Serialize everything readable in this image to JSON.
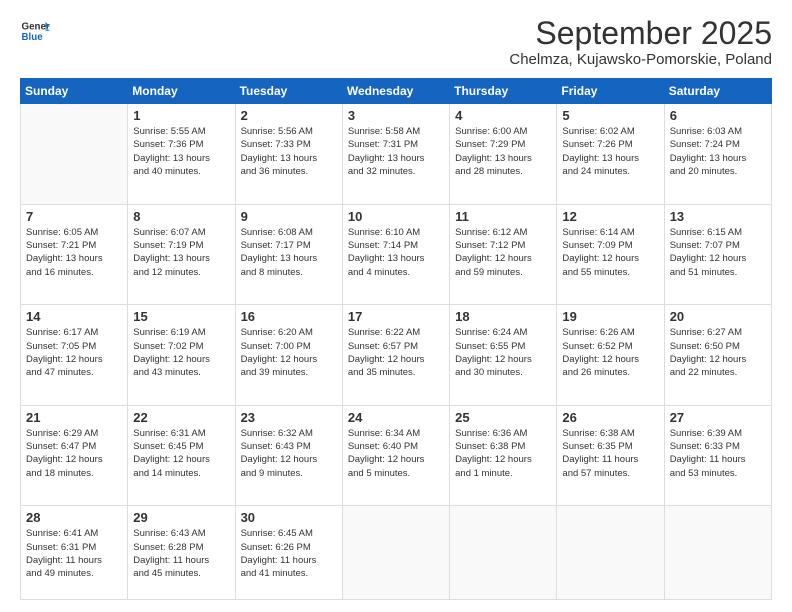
{
  "logo": {
    "general": "General",
    "blue": "Blue"
  },
  "header": {
    "month": "September 2025",
    "location": "Chelmza, Kujawsko-Pomorskie, Poland"
  },
  "weekdays": [
    "Sunday",
    "Monday",
    "Tuesday",
    "Wednesday",
    "Thursday",
    "Friday",
    "Saturday"
  ],
  "weeks": [
    [
      {
        "day": "",
        "info": ""
      },
      {
        "day": "1",
        "info": "Sunrise: 5:55 AM\nSunset: 7:36 PM\nDaylight: 13 hours\nand 40 minutes."
      },
      {
        "day": "2",
        "info": "Sunrise: 5:56 AM\nSunset: 7:33 PM\nDaylight: 13 hours\nand 36 minutes."
      },
      {
        "day": "3",
        "info": "Sunrise: 5:58 AM\nSunset: 7:31 PM\nDaylight: 13 hours\nand 32 minutes."
      },
      {
        "day": "4",
        "info": "Sunrise: 6:00 AM\nSunset: 7:29 PM\nDaylight: 13 hours\nand 28 minutes."
      },
      {
        "day": "5",
        "info": "Sunrise: 6:02 AM\nSunset: 7:26 PM\nDaylight: 13 hours\nand 24 minutes."
      },
      {
        "day": "6",
        "info": "Sunrise: 6:03 AM\nSunset: 7:24 PM\nDaylight: 13 hours\nand 20 minutes."
      }
    ],
    [
      {
        "day": "7",
        "info": "Sunrise: 6:05 AM\nSunset: 7:21 PM\nDaylight: 13 hours\nand 16 minutes."
      },
      {
        "day": "8",
        "info": "Sunrise: 6:07 AM\nSunset: 7:19 PM\nDaylight: 13 hours\nand 12 minutes."
      },
      {
        "day": "9",
        "info": "Sunrise: 6:08 AM\nSunset: 7:17 PM\nDaylight: 13 hours\nand 8 minutes."
      },
      {
        "day": "10",
        "info": "Sunrise: 6:10 AM\nSunset: 7:14 PM\nDaylight: 13 hours\nand 4 minutes."
      },
      {
        "day": "11",
        "info": "Sunrise: 6:12 AM\nSunset: 7:12 PM\nDaylight: 12 hours\nand 59 minutes."
      },
      {
        "day": "12",
        "info": "Sunrise: 6:14 AM\nSunset: 7:09 PM\nDaylight: 12 hours\nand 55 minutes."
      },
      {
        "day": "13",
        "info": "Sunrise: 6:15 AM\nSunset: 7:07 PM\nDaylight: 12 hours\nand 51 minutes."
      }
    ],
    [
      {
        "day": "14",
        "info": "Sunrise: 6:17 AM\nSunset: 7:05 PM\nDaylight: 12 hours\nand 47 minutes."
      },
      {
        "day": "15",
        "info": "Sunrise: 6:19 AM\nSunset: 7:02 PM\nDaylight: 12 hours\nand 43 minutes."
      },
      {
        "day": "16",
        "info": "Sunrise: 6:20 AM\nSunset: 7:00 PM\nDaylight: 12 hours\nand 39 minutes."
      },
      {
        "day": "17",
        "info": "Sunrise: 6:22 AM\nSunset: 6:57 PM\nDaylight: 12 hours\nand 35 minutes."
      },
      {
        "day": "18",
        "info": "Sunrise: 6:24 AM\nSunset: 6:55 PM\nDaylight: 12 hours\nand 30 minutes."
      },
      {
        "day": "19",
        "info": "Sunrise: 6:26 AM\nSunset: 6:52 PM\nDaylight: 12 hours\nand 26 minutes."
      },
      {
        "day": "20",
        "info": "Sunrise: 6:27 AM\nSunset: 6:50 PM\nDaylight: 12 hours\nand 22 minutes."
      }
    ],
    [
      {
        "day": "21",
        "info": "Sunrise: 6:29 AM\nSunset: 6:47 PM\nDaylight: 12 hours\nand 18 minutes."
      },
      {
        "day": "22",
        "info": "Sunrise: 6:31 AM\nSunset: 6:45 PM\nDaylight: 12 hours\nand 14 minutes."
      },
      {
        "day": "23",
        "info": "Sunrise: 6:32 AM\nSunset: 6:43 PM\nDaylight: 12 hours\nand 9 minutes."
      },
      {
        "day": "24",
        "info": "Sunrise: 6:34 AM\nSunset: 6:40 PM\nDaylight: 12 hours\nand 5 minutes."
      },
      {
        "day": "25",
        "info": "Sunrise: 6:36 AM\nSunset: 6:38 PM\nDaylight: 12 hours\nand 1 minute."
      },
      {
        "day": "26",
        "info": "Sunrise: 6:38 AM\nSunset: 6:35 PM\nDaylight: 11 hours\nand 57 minutes."
      },
      {
        "day": "27",
        "info": "Sunrise: 6:39 AM\nSunset: 6:33 PM\nDaylight: 11 hours\nand 53 minutes."
      }
    ],
    [
      {
        "day": "28",
        "info": "Sunrise: 6:41 AM\nSunset: 6:31 PM\nDaylight: 11 hours\nand 49 minutes."
      },
      {
        "day": "29",
        "info": "Sunrise: 6:43 AM\nSunset: 6:28 PM\nDaylight: 11 hours\nand 45 minutes."
      },
      {
        "day": "30",
        "info": "Sunrise: 6:45 AM\nSunset: 6:26 PM\nDaylight: 11 hours\nand 41 minutes."
      },
      {
        "day": "",
        "info": ""
      },
      {
        "day": "",
        "info": ""
      },
      {
        "day": "",
        "info": ""
      },
      {
        "day": "",
        "info": ""
      }
    ]
  ]
}
